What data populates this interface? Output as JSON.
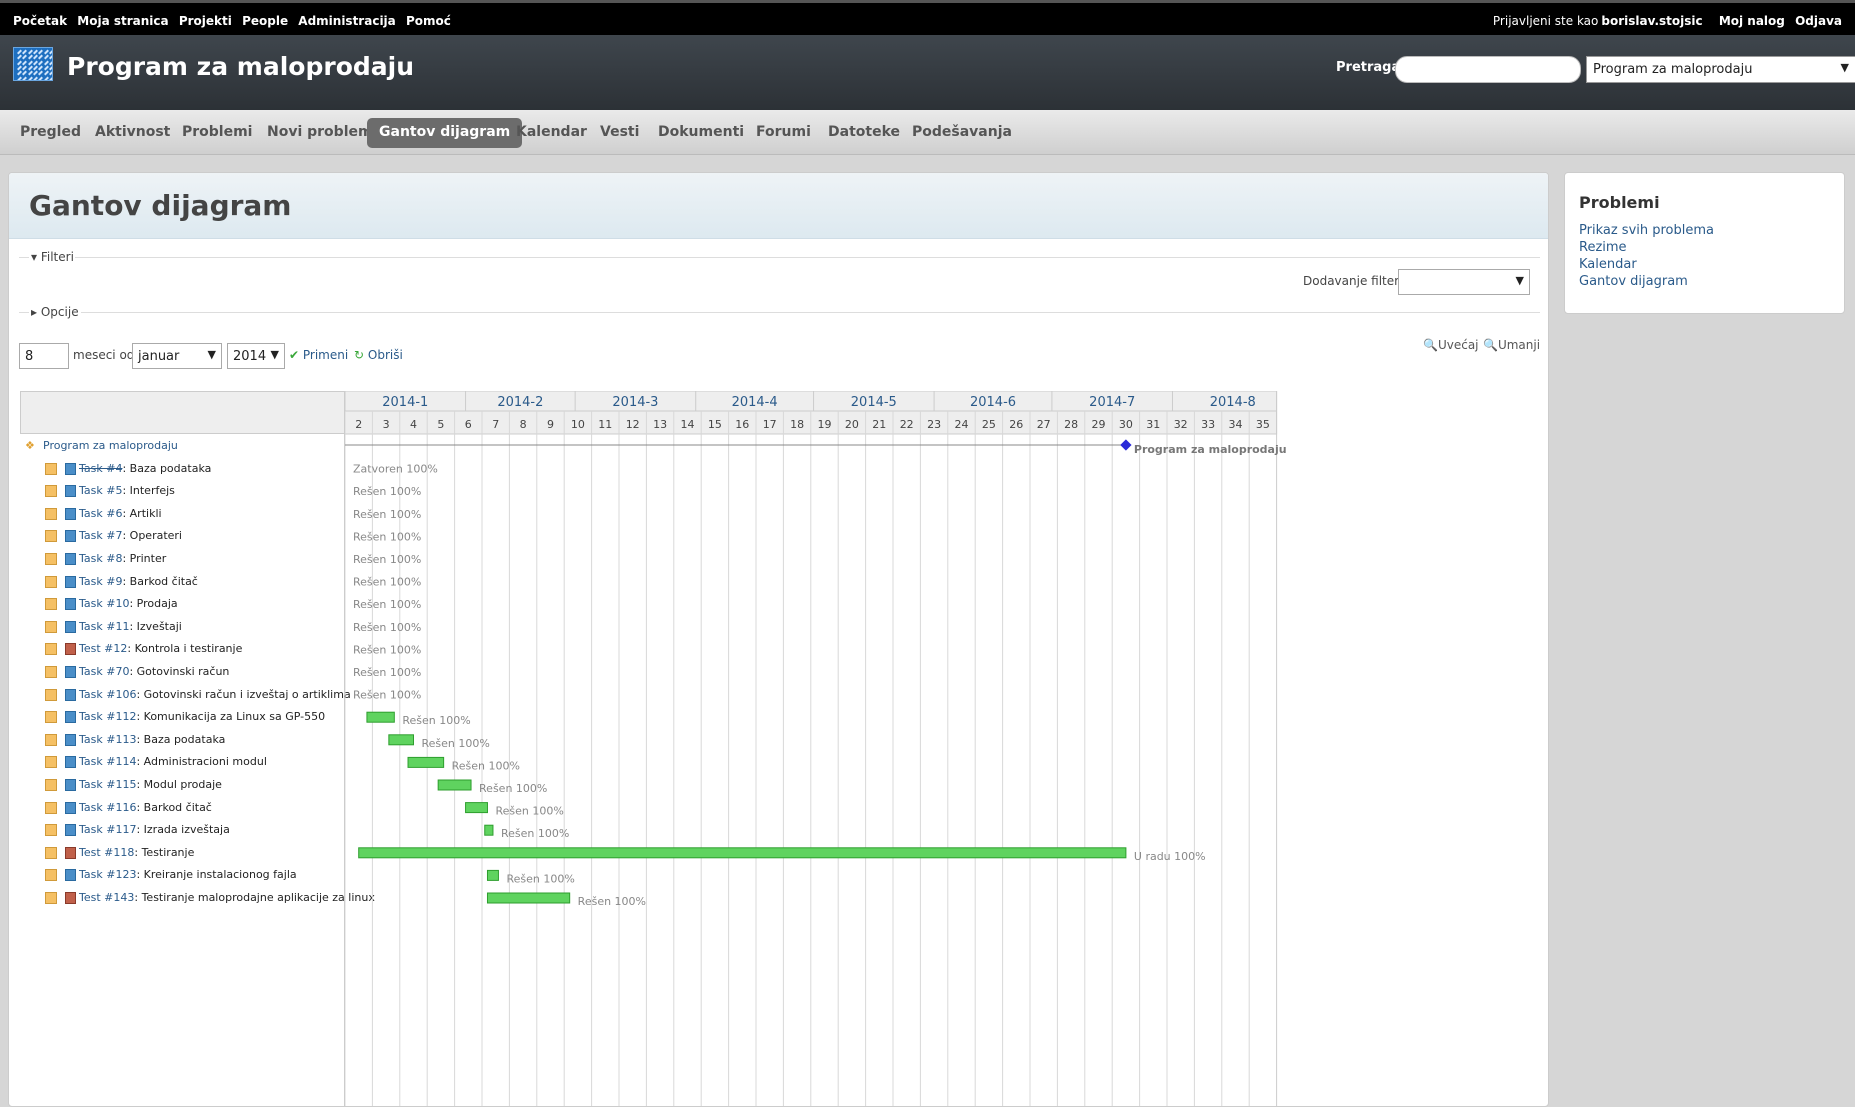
{
  "topmenu": {
    "items": [
      "Početak",
      "Moja stranica",
      "Projekti",
      "People",
      "Administracija",
      "Pomoć"
    ],
    "logged_as_label": "Prijavljeni ste kao",
    "user": "borislav.stojsic",
    "my_account": "Moj nalog",
    "logout": "Odjava"
  },
  "header": {
    "title": "Program za maloprodaju",
    "search_label": "Pretraga:",
    "project_select": "Program za maloprodaju"
  },
  "mainmenu": {
    "tabs": [
      "Pregled",
      "Aktivnost",
      "Problemi",
      "Novi problem",
      "Gantov dijagram",
      "Kalendar",
      "Vesti",
      "Dokumenti",
      "Forumi",
      "Datoteke",
      "Podešavanja"
    ],
    "selected": "Gantov dijagram"
  },
  "page": {
    "title": "Gantov dijagram",
    "filters_label": "Filteri",
    "add_filter_label": "Dodavanje filtera",
    "options_label": "Opcije",
    "months_value": "8",
    "months_from_label": "meseci od",
    "month_select": "januar",
    "year_select": "2014",
    "apply_label": "Primeni",
    "clear_label": "Obriši",
    "zoom_in_label": "Uvećaj",
    "zoom_out_label": "Umanji"
  },
  "sidebar": {
    "title": "Problemi",
    "links": [
      "Prikaz svih problema",
      "Rezime",
      "Kalendar",
      "Gantov dijagram"
    ]
  },
  "colors": {
    "bar": "#5fd35f",
    "bar_border": "#2e9e2e",
    "milestone": "#2a2ad8",
    "selected_tab": "#6c6c6c"
  },
  "gantt": {
    "months": [
      "2014-1",
      "2014-2",
      "2014-3",
      "2014-4",
      "2014-5",
      "2014-6",
      "2014-7",
      "2014-8"
    ],
    "month_week_spans": [
      4.4,
      4,
      4.4,
      4.3,
      4.4,
      4.3,
      4.4,
      4.4
    ],
    "weeks": [
      "2",
      "3",
      "4",
      "5",
      "6",
      "7",
      "8",
      "9",
      "10",
      "11",
      "12",
      "13",
      "14",
      "15",
      "16",
      "17",
      "18",
      "19",
      "20",
      "21",
      "22",
      "23",
      "24",
      "25",
      "26",
      "27",
      "28",
      "29",
      "30",
      "31",
      "32",
      "33",
      "34",
      "35"
    ],
    "project": {
      "name": "Program za maloprodaju",
      "end_week": 30.0
    },
    "issues": [
      {
        "tracker": "Task",
        "id": "#4",
        "subject": "Baza podataka",
        "closed": true,
        "status": "Zatvoren 100%"
      },
      {
        "tracker": "Task",
        "id": "#5",
        "subject": "Interfejs",
        "status": "Rešen 100%"
      },
      {
        "tracker": "Task",
        "id": "#6",
        "subject": "Artikli",
        "status": "Rešen 100%"
      },
      {
        "tracker": "Task",
        "id": "#7",
        "subject": "Operateri",
        "status": "Rešen 100%"
      },
      {
        "tracker": "Task",
        "id": "#8",
        "subject": "Printer",
        "status": "Rešen 100%"
      },
      {
        "tracker": "Task",
        "id": "#9",
        "subject": "Barkod čitač",
        "status": "Rešen 100%"
      },
      {
        "tracker": "Task",
        "id": "#10",
        "subject": "Prodaja",
        "status": "Rešen 100%"
      },
      {
        "tracker": "Task",
        "id": "#11",
        "subject": "Izveštaji",
        "status": "Rešen 100%"
      },
      {
        "tracker": "Test",
        "id": "#12",
        "subject": "Kontrola i testiranje",
        "status": "Rešen 100%"
      },
      {
        "tracker": "Task",
        "id": "#70",
        "subject": "Gotovinski račun",
        "status": "Rešen 100%"
      },
      {
        "tracker": "Task",
        "id": "#106",
        "subject": "Gotovinski račun i izveštaj o artiklima",
        "status": "Rešen 100%"
      },
      {
        "tracker": "Task",
        "id": "#112",
        "subject": "Komunikacija za Linux sa GP-550",
        "status": "Rešen 100%",
        "start_week": 2.3,
        "end_week": 3.3
      },
      {
        "tracker": "Task",
        "id": "#113",
        "subject": "Baza podataka",
        "status": "Rešen 100%",
        "start_week": 3.1,
        "end_week": 4.0
      },
      {
        "tracker": "Task",
        "id": "#114",
        "subject": "Administracioni modul",
        "status": "Rešen 100%",
        "start_week": 3.8,
        "end_week": 5.1
      },
      {
        "tracker": "Task",
        "id": "#115",
        "subject": "Modul prodaje",
        "status": "Rešen 100%",
        "start_week": 4.9,
        "end_week": 6.1
      },
      {
        "tracker": "Task",
        "id": "#116",
        "subject": "Barkod čitač",
        "status": "Rešen 100%",
        "start_week": 5.9,
        "end_week": 6.7
      },
      {
        "tracker": "Task",
        "id": "#117",
        "subject": "Izrada izveštaja",
        "status": "Rešen 100%",
        "start_week": 6.6,
        "end_week": 6.9
      },
      {
        "tracker": "Test",
        "id": "#118",
        "subject": "Testiranje",
        "status": "U radu 100%",
        "start_week": 2.0,
        "end_week": 30.0
      },
      {
        "tracker": "Task",
        "id": "#123",
        "subject": "Kreiranje instalacionog fajla",
        "status": "Rešen 100%",
        "start_week": 6.7,
        "end_week": 7.1
      },
      {
        "tracker": "Test",
        "id": "#143",
        "subject": "Testiranje maloprodajne aplikacije za linux",
        "status": "Rešen 100%",
        "start_week": 6.7,
        "end_week": 9.7
      }
    ]
  }
}
